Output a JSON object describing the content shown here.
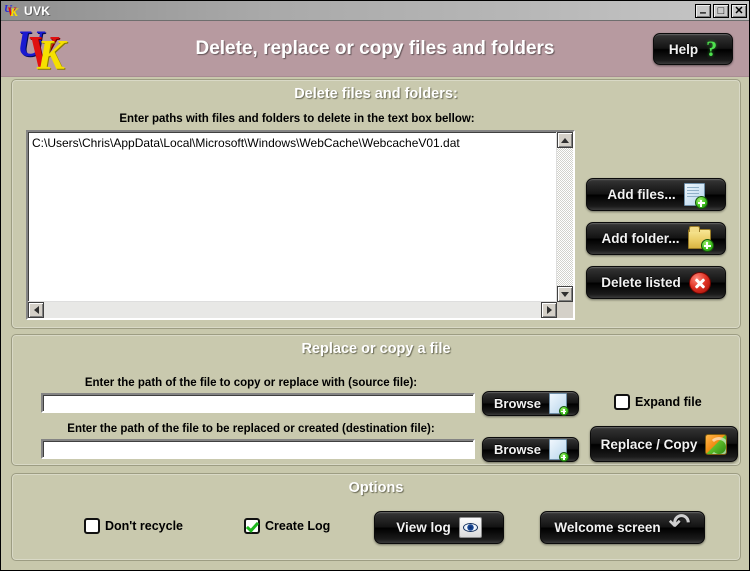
{
  "window": {
    "title": "UVK",
    "icon": "uvk-logo-icon",
    "controls": {
      "minimize": "–",
      "maximize": "□",
      "close": "✕"
    }
  },
  "header": {
    "title": "Delete, replace or copy files and folders",
    "logo": {
      "u": "U",
      "v": "V",
      "k": "K"
    },
    "help_label": "Help",
    "help_icon": "question-mark-icon",
    "background_color": "#b79aa0"
  },
  "delete_section": {
    "title": "Delete files and folders:",
    "instruction": "Enter paths with files and folders to delete in the text box bellow:",
    "paths_value": "C:\\Users\\Chris\\AppData\\Local\\Microsoft\\Windows\\WebCache\\WebcacheV01.dat",
    "buttons": [
      {
        "label": "Add files...",
        "icon": "file-add-icon"
      },
      {
        "label": "Add folder...",
        "icon": "folder-add-icon"
      },
      {
        "label": "Delete listed",
        "icon": "delete-red-x-icon"
      }
    ]
  },
  "replace_section": {
    "title": "Replace or copy a file",
    "source_label": "Enter the path of the file to copy or replace with (source file):",
    "source_value": "",
    "source_placeholder": "",
    "destination_label": "Enter the path of the file to be replaced or created (destination file):",
    "destination_value": "",
    "destination_placeholder": "",
    "browse_source_label": "Browse",
    "browse_destination_label": "Browse",
    "browse_icon": "browse-file-icon",
    "expand_file_label": "Expand file",
    "expand_file_checked": false,
    "replace_copy_label": "Replace / Copy",
    "replace_copy_icon": "refresh-arrows-icon"
  },
  "options_section": {
    "title": "Options",
    "dont_recycle_label": "Don't recycle",
    "dont_recycle_checked": false,
    "create_log_label": "Create Log",
    "create_log_checked": true,
    "view_log_label": "View log",
    "view_log_icon": "eye-icon",
    "welcome_screen_label": "Welcome screen",
    "welcome_screen_icon": "back-arrow-icon"
  },
  "theme": {
    "panel_bg": "#c9c9ae",
    "header_bg": "#b79aa0",
    "button_bg": "#101010",
    "accent_green": "#3fbe1e",
    "accent_red": "#e03224"
  }
}
